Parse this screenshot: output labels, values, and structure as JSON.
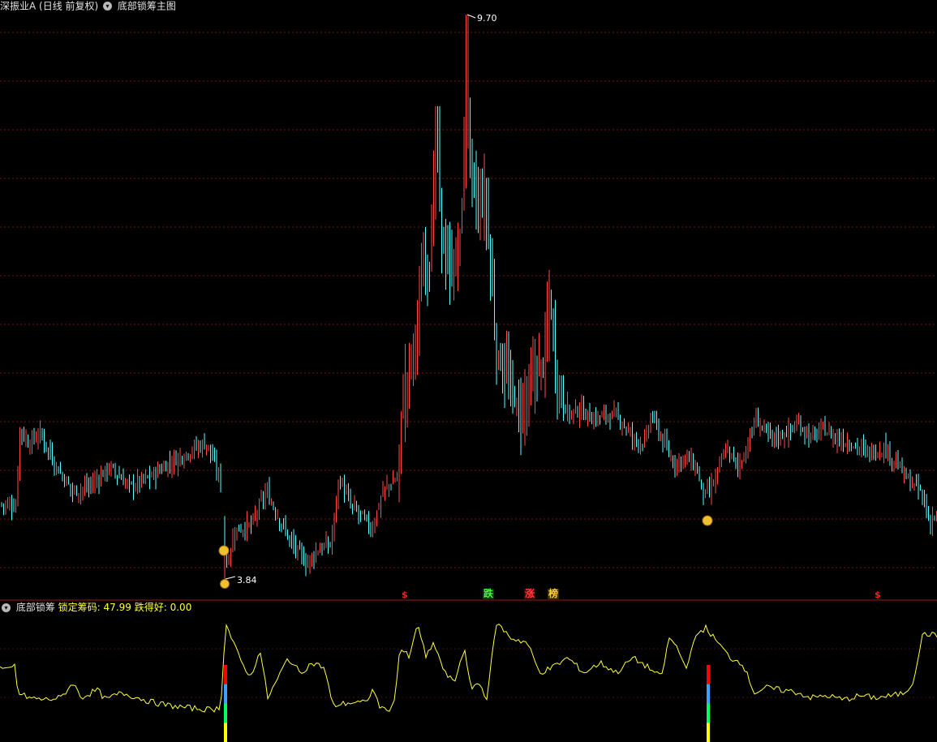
{
  "header": {
    "stock_name": "深振业A",
    "period": "(日线 前复权)",
    "main_indicator": "底部锁筹主图"
  },
  "sub_panel": {
    "indicator": "底部锁筹",
    "lock_label": "锁定筹码:",
    "lock_value": "47.99",
    "fall_label": "跌得好:",
    "fall_value": "0.00"
  },
  "annotations": {
    "high": "9.70",
    "low": "3.84",
    "signal_s": "$",
    "tag_fall": "跌",
    "tag_rise": "涨",
    "tag_rank": "榜"
  },
  "colors": {
    "up": "#ff4a4a",
    "down": "#54ffff",
    "grid": "#7a1212",
    "line": "#ffff40"
  },
  "chart_data": {
    "type": "candlestick",
    "price_range": [
      3.84,
      9.7
    ],
    "high_label": 9.7,
    "low_label": 3.84,
    "close_path": [
      [
        0,
        4.62
      ],
      [
        20,
        4.6
      ],
      [
        24,
        5.4
      ],
      [
        35,
        5.25
      ],
      [
        50,
        5.35
      ],
      [
        70,
        5.0
      ],
      [
        90,
        4.75
      ],
      [
        110,
        4.8
      ],
      [
        135,
        5.0
      ],
      [
        160,
        4.8
      ],
      [
        185,
        4.9
      ],
      [
        210,
        5.05
      ],
      [
        240,
        5.2
      ],
      [
        255,
        5.25
      ],
      [
        272,
        4.85
      ],
      [
        278,
        3.95
      ],
      [
        290,
        4.35
      ],
      [
        310,
        4.4
      ],
      [
        328,
        4.75
      ],
      [
        345,
        4.45
      ],
      [
        360,
        4.2
      ],
      [
        378,
        4.0
      ],
      [
        392,
        4.15
      ],
      [
        408,
        4.2
      ],
      [
        418,
        4.9
      ],
      [
        432,
        4.6
      ],
      [
        445,
        4.5
      ],
      [
        458,
        4.35
      ],
      [
        472,
        4.75
      ],
      [
        490,
        4.9
      ],
      [
        495,
        5.6
      ],
      [
        505,
        6.1
      ],
      [
        515,
        6.5
      ],
      [
        522,
        7.15
      ],
      [
        530,
        7.1
      ],
      [
        538,
        8.6
      ],
      [
        545,
        7.3
      ],
      [
        558,
        7.0
      ],
      [
        567,
        7.4
      ],
      [
        576,
        8.8
      ],
      [
        583,
        7.9
      ],
      [
        590,
        7.7
      ],
      [
        598,
        7.8
      ],
      [
        605,
        7.05
      ],
      [
        612,
        6.15
      ],
      [
        625,
        5.95
      ],
      [
        640,
        5.55
      ],
      [
        650,
        5.75
      ],
      [
        660,
        6.0
      ],
      [
        670,
        6.1
      ],
      [
        678,
        6.8
      ],
      [
        685,
        5.95
      ],
      [
        700,
        5.55
      ],
      [
        715,
        5.6
      ],
      [
        730,
        5.5
      ],
      [
        750,
        5.55
      ],
      [
        765,
        5.5
      ],
      [
        780,
        5.3
      ],
      [
        795,
        5.25
      ],
      [
        803,
        5.55
      ],
      [
        815,
        5.3
      ],
      [
        830,
        5.05
      ],
      [
        845,
        5.1
      ],
      [
        858,
        5.0
      ],
      [
        868,
        4.7
      ],
      [
        875,
        4.75
      ],
      [
        885,
        4.95
      ],
      [
        895,
        5.2
      ],
      [
        910,
        5.0
      ],
      [
        920,
        5.2
      ],
      [
        932,
        5.5
      ],
      [
        950,
        5.3
      ],
      [
        968,
        5.35
      ],
      [
        985,
        5.45
      ],
      [
        1000,
        5.3
      ],
      [
        1015,
        5.4
      ],
      [
        1030,
        5.3
      ],
      [
        1050,
        5.25
      ],
      [
        1070,
        5.15
      ],
      [
        1090,
        5.2
      ],
      [
        1105,
        5.05
      ],
      [
        1120,
        4.85
      ],
      [
        1135,
        4.75
      ],
      [
        1145,
        4.45
      ],
      [
        1155,
        4.5
      ]
    ],
    "subchart": {
      "series": "锁定筹码",
      "last_value": 47.99,
      "fall_value": 0.0,
      "path": [
        [
          0,
          50
        ],
        [
          10,
          47
        ],
        [
          18,
          52
        ],
        [
          22,
          25
        ],
        [
          35,
          20
        ],
        [
          55,
          18
        ],
        [
          75,
          20
        ],
        [
          90,
          35
        ],
        [
          100,
          20
        ],
        [
          120,
          28
        ],
        [
          130,
          18
        ],
        [
          150,
          25
        ],
        [
          170,
          20
        ],
        [
          190,
          15
        ],
        [
          210,
          12
        ],
        [
          230,
          10
        ],
        [
          260,
          8
        ],
        [
          272,
          10
        ],
        [
          278,
          95
        ],
        [
          290,
          70
        ],
        [
          298,
          55
        ],
        [
          310,
          40
        ],
        [
          320,
          70
        ],
        [
          330,
          20
        ],
        [
          340,
          35
        ],
        [
          355,
          60
        ],
        [
          370,
          45
        ],
        [
          385,
          55
        ],
        [
          400,
          50
        ],
        [
          410,
          12
        ],
        [
          430,
          15
        ],
        [
          450,
          15
        ],
        [
          460,
          28
        ],
        [
          470,
          8
        ],
        [
          485,
          10
        ],
        [
          493,
          70
        ],
        [
          505,
          60
        ],
        [
          515,
          95
        ],
        [
          525,
          60
        ],
        [
          535,
          75
        ],
        [
          548,
          45
        ],
        [
          560,
          35
        ],
        [
          572,
          70
        ],
        [
          580,
          30
        ],
        [
          590,
          35
        ],
        [
          600,
          20
        ],
        [
          612,
          95
        ],
        [
          630,
          80
        ],
        [
          650,
          75
        ],
        [
          665,
          45
        ],
        [
          680,
          50
        ],
        [
          700,
          60
        ],
        [
          720,
          45
        ],
        [
          740,
          55
        ],
        [
          760,
          45
        ],
        [
          780,
          60
        ],
        [
          800,
          50
        ],
        [
          815,
          40
        ],
        [
          825,
          80
        ],
        [
          835,
          70
        ],
        [
          845,
          50
        ],
        [
          860,
          85
        ],
        [
          870,
          90
        ],
        [
          880,
          80
        ],
        [
          890,
          70
        ],
        [
          900,
          60
        ],
        [
          915,
          55
        ],
        [
          930,
          25
        ],
        [
          945,
          30
        ],
        [
          960,
          28
        ],
        [
          980,
          26
        ],
        [
          1000,
          20
        ],
        [
          1020,
          22
        ],
        [
          1040,
          18
        ],
        [
          1060,
          22
        ],
        [
          1080,
          20
        ],
        [
          1100,
          22
        ],
        [
          1115,
          25
        ],
        [
          1125,
          35
        ],
        [
          1138,
          85
        ],
        [
          1155,
          82
        ]
      ],
      "bars": [
        {
          "x": 278,
          "segments": [
            "#ff0000",
            "#40a0ff",
            "#00ff60",
            "#ffff00"
          ]
        },
        {
          "x": 873,
          "segments": [
            "#ff0000",
            "#40a0ff",
            "#00ff60",
            "#ffff00"
          ]
        }
      ]
    }
  }
}
